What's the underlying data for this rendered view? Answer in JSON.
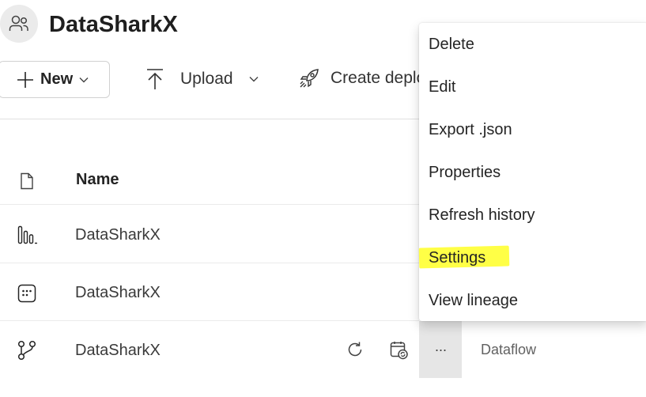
{
  "workspace": {
    "title": "DataSharkX",
    "icon": "people-group-icon"
  },
  "toolbar": {
    "new_label": "New",
    "upload_label": "Upload",
    "deploy_label": "Create deplo"
  },
  "table": {
    "name_header": "Name",
    "rows": [
      {
        "name": "DataSharkX",
        "icon": "report-bars-icon"
      },
      {
        "name": "DataSharkX",
        "icon": "semantic-model-icon"
      },
      {
        "name": "DataSharkX",
        "icon": "dataflow-icon",
        "type": "Dataflow",
        "more": "···"
      }
    ]
  },
  "context_menu": {
    "items": [
      "Delete",
      "Edit",
      "Export .json",
      "Properties",
      "Refresh history",
      "Settings",
      "View lineage"
    ],
    "highlighted": "Settings",
    "highlight_color": "#ffff3c"
  }
}
